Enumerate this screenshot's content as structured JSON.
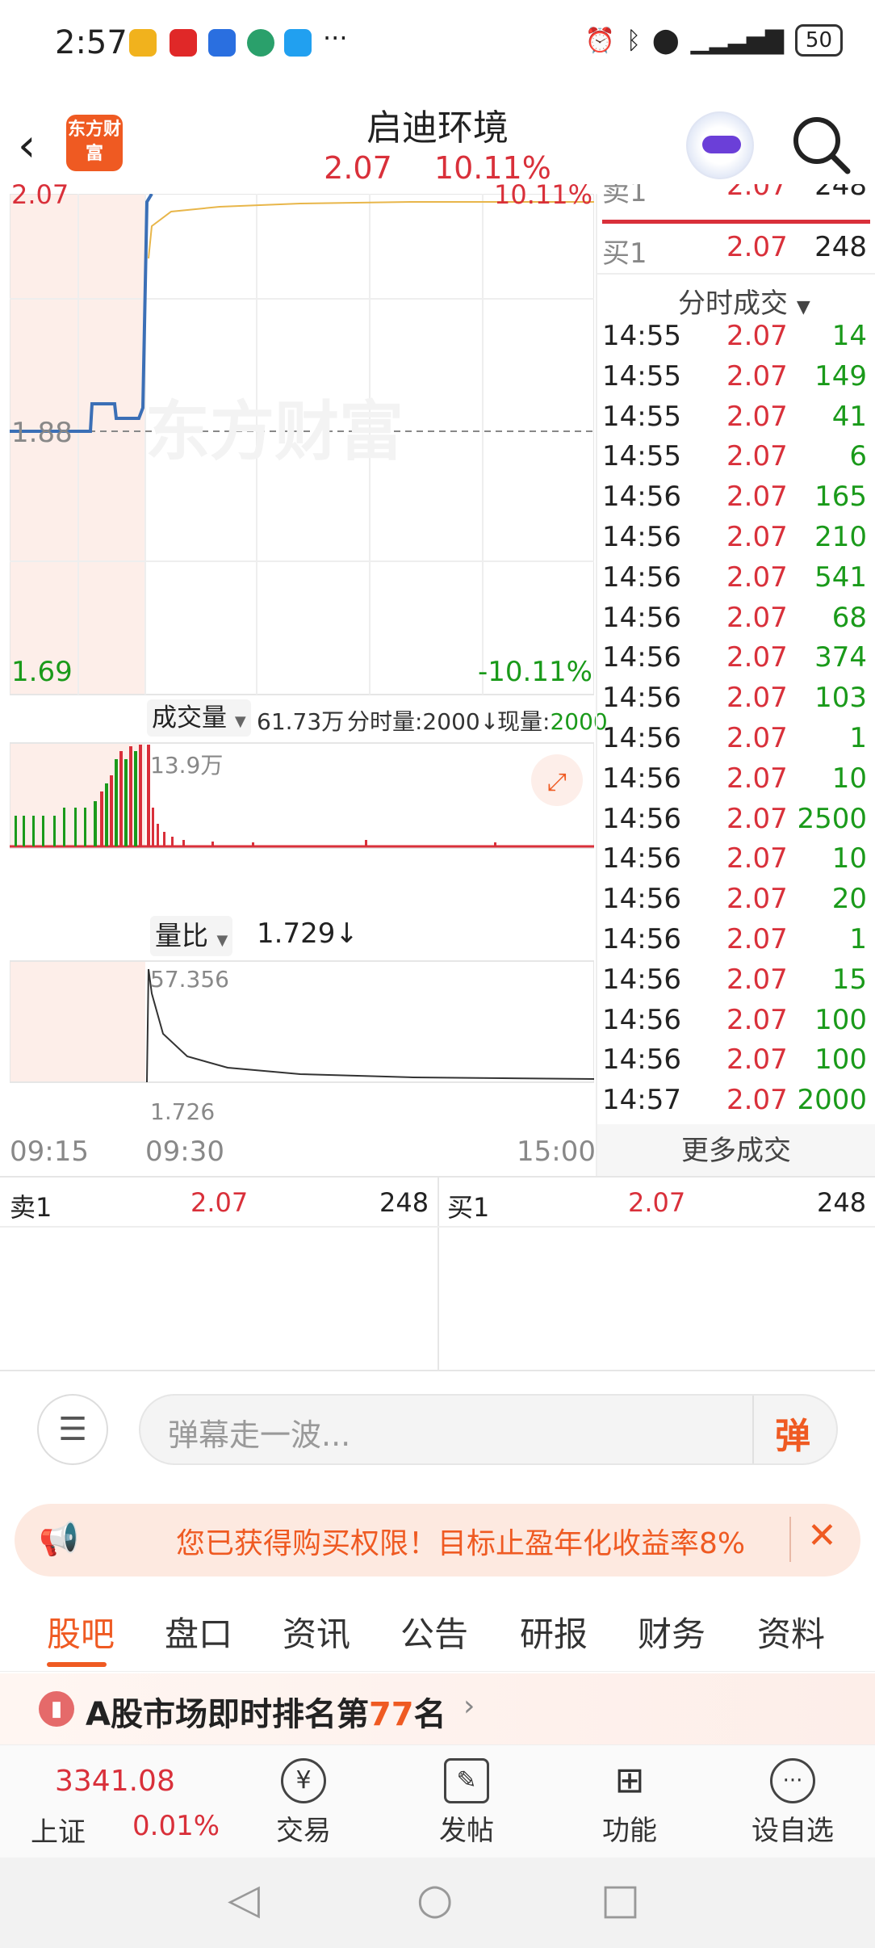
{
  "status_bar": {
    "time": "2:57",
    "battery": "50"
  },
  "header": {
    "logo_text": "东方财富",
    "stock_name": "启迪环境",
    "price": "2.07",
    "change_pct": "10.11%"
  },
  "chart": {
    "top_price": "2.07",
    "top_pct": "10.11%",
    "mid_price": "1.88",
    "bottom_price": "1.69",
    "bottom_pct": "-10.11%",
    "watermark": "东方财富",
    "volume_dropdown": "成交量",
    "volume_total": "61.73万",
    "tick_volume_label": "分时量:2000↓",
    "current_volume_label": "现量:",
    "current_volume_value": "2000",
    "volume_peak": "13.9万",
    "ratio_dropdown": "量比",
    "ratio_value": "1.729↓",
    "ratio_peak": "57.356",
    "ratio_low": "1.726",
    "time_start": "09:15",
    "time_open": "09:30",
    "time_end": "15:00"
  },
  "tape": {
    "ask1_label": "卖1",
    "ask1_price": "2.07",
    "ask1_vol": "248",
    "bid1_label": "买1",
    "bid1_price": "2.07",
    "bid1_vol": "248",
    "header": "分时成交",
    "more": "更多成交",
    "trades": [
      {
        "time": "14:55",
        "price": "2.07",
        "vol": "14"
      },
      {
        "time": "14:55",
        "price": "2.07",
        "vol": "149"
      },
      {
        "time": "14:55",
        "price": "2.07",
        "vol": "41"
      },
      {
        "time": "14:55",
        "price": "2.07",
        "vol": "6"
      },
      {
        "time": "14:56",
        "price": "2.07",
        "vol": "165"
      },
      {
        "time": "14:56",
        "price": "2.07",
        "vol": "210"
      },
      {
        "time": "14:56",
        "price": "2.07",
        "vol": "541"
      },
      {
        "time": "14:56",
        "price": "2.07",
        "vol": "68"
      },
      {
        "time": "14:56",
        "price": "2.07",
        "vol": "374"
      },
      {
        "time": "14:56",
        "price": "2.07",
        "vol": "103"
      },
      {
        "time": "14:56",
        "price": "2.07",
        "vol": "1"
      },
      {
        "time": "14:56",
        "price": "2.07",
        "vol": "10"
      },
      {
        "time": "14:56",
        "price": "2.07",
        "vol": "2500"
      },
      {
        "time": "14:56",
        "price": "2.07",
        "vol": "10"
      },
      {
        "time": "14:56",
        "price": "2.07",
        "vol": "20"
      },
      {
        "time": "14:56",
        "price": "2.07",
        "vol": "1"
      },
      {
        "time": "14:56",
        "price": "2.07",
        "vol": "15"
      },
      {
        "time": "14:56",
        "price": "2.07",
        "vol": "100"
      },
      {
        "time": "14:56",
        "price": "2.07",
        "vol": "100"
      },
      {
        "time": "14:57",
        "price": "2.07",
        "vol": "2000"
      }
    ]
  },
  "order_book": {
    "ask_label": "卖1",
    "ask_price": "2.07",
    "ask_vol": "248",
    "bid_label": "买1",
    "bid_price": "2.07",
    "bid_vol": "248"
  },
  "comment_bar": {
    "placeholder": "弹幕走一波...",
    "danmu_button": "弹"
  },
  "banner": {
    "text": "您已获得购买权限！目标止盈年化收益率8%"
  },
  "tabs": [
    "股吧",
    "盘口",
    "资讯",
    "公告",
    "研报",
    "财务",
    "资料"
  ],
  "ranking": {
    "prefix": "A股市场即时排名第",
    "rank": "77",
    "suffix": "名"
  },
  "bottom_nav": {
    "index_value": "3341.08",
    "index_name": "上证",
    "index_change": "0.01%",
    "items": [
      "交易",
      "发帖",
      "功能",
      "设自选"
    ]
  },
  "colors": {
    "up": "#d9303a",
    "down": "#1a9a1a",
    "accent": "#ef5a22",
    "price_line": "#3b6fb6",
    "avg_line": "#e8b64a"
  }
}
